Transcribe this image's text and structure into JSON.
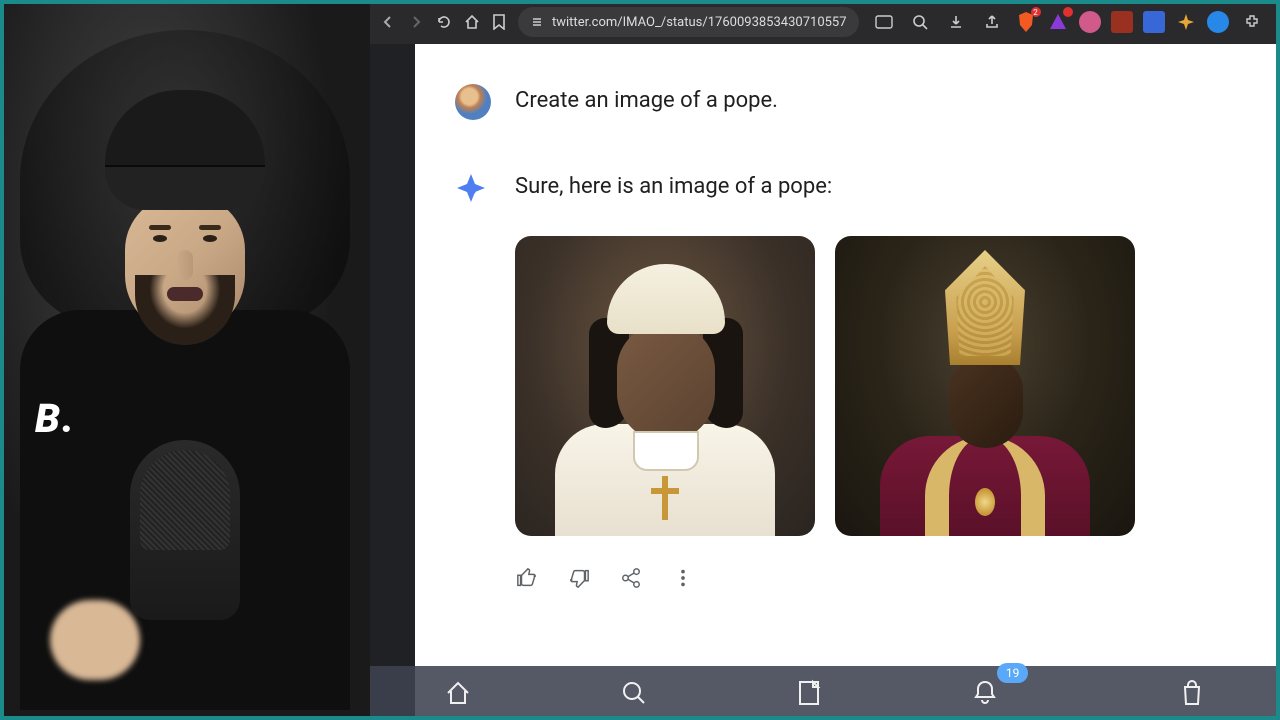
{
  "toolbar": {
    "url": "twitter.com/IMAO_/status/1760093853430710557",
    "brave_badge": "2"
  },
  "chat": {
    "user_prompt": "Create an image of a pope.",
    "ai_response": "Sure, here is an image of a pope:"
  },
  "overlay": {
    "notification_count": "19"
  },
  "webcam": {
    "brand_text": "B."
  }
}
